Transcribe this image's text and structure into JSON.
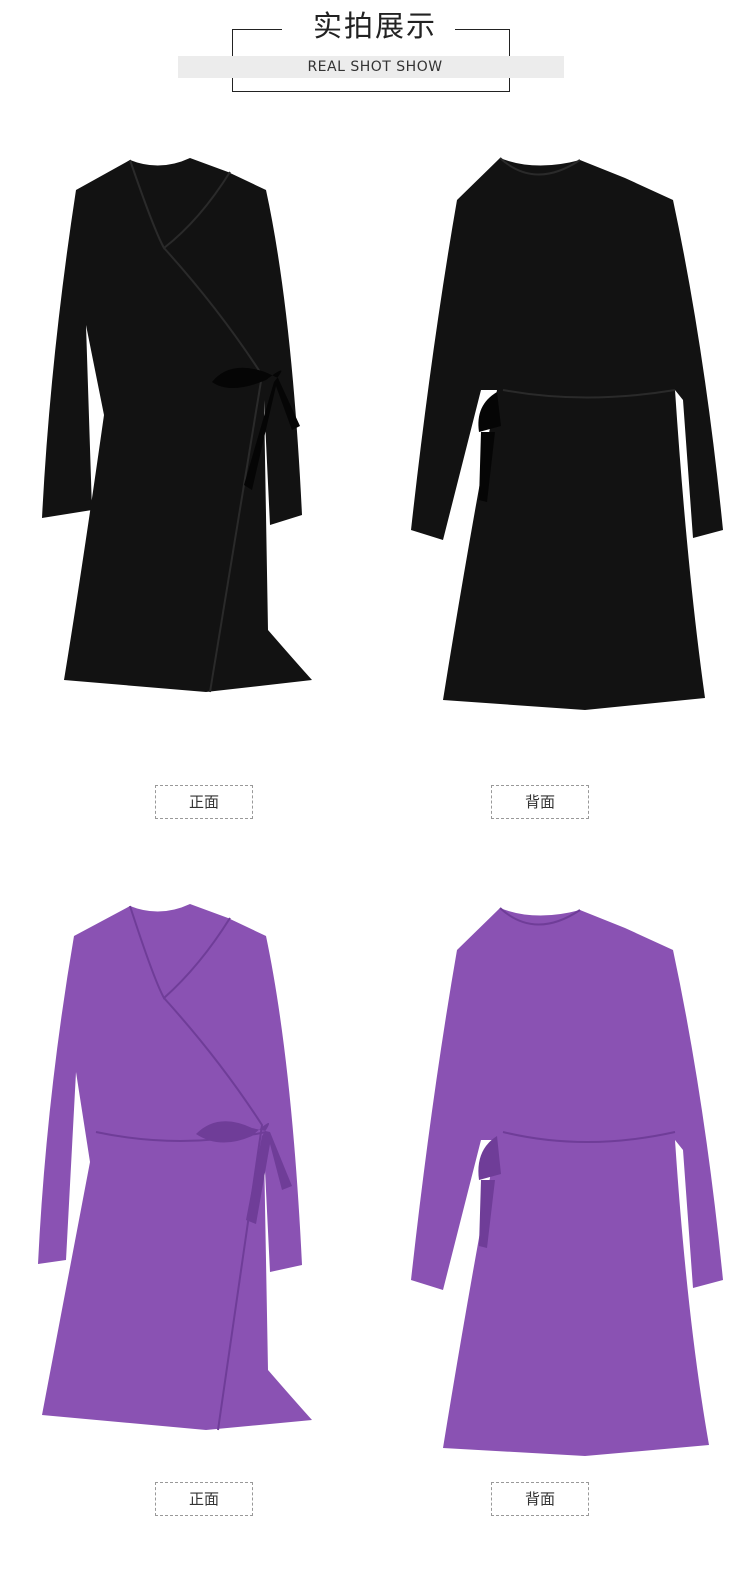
{
  "header": {
    "title": "实拍展示",
    "subtitle": "REAL SHOT SHOW"
  },
  "panels": [
    {
      "color": "black",
      "fill": "#121212",
      "caption": "正面"
    },
    {
      "color": "black",
      "fill": "#121212",
      "caption": "背面"
    },
    {
      "color": "purple",
      "fill": "#8a52b3",
      "caption": "正面"
    },
    {
      "color": "purple",
      "fill": "#8a52b3",
      "caption": "背面"
    }
  ]
}
